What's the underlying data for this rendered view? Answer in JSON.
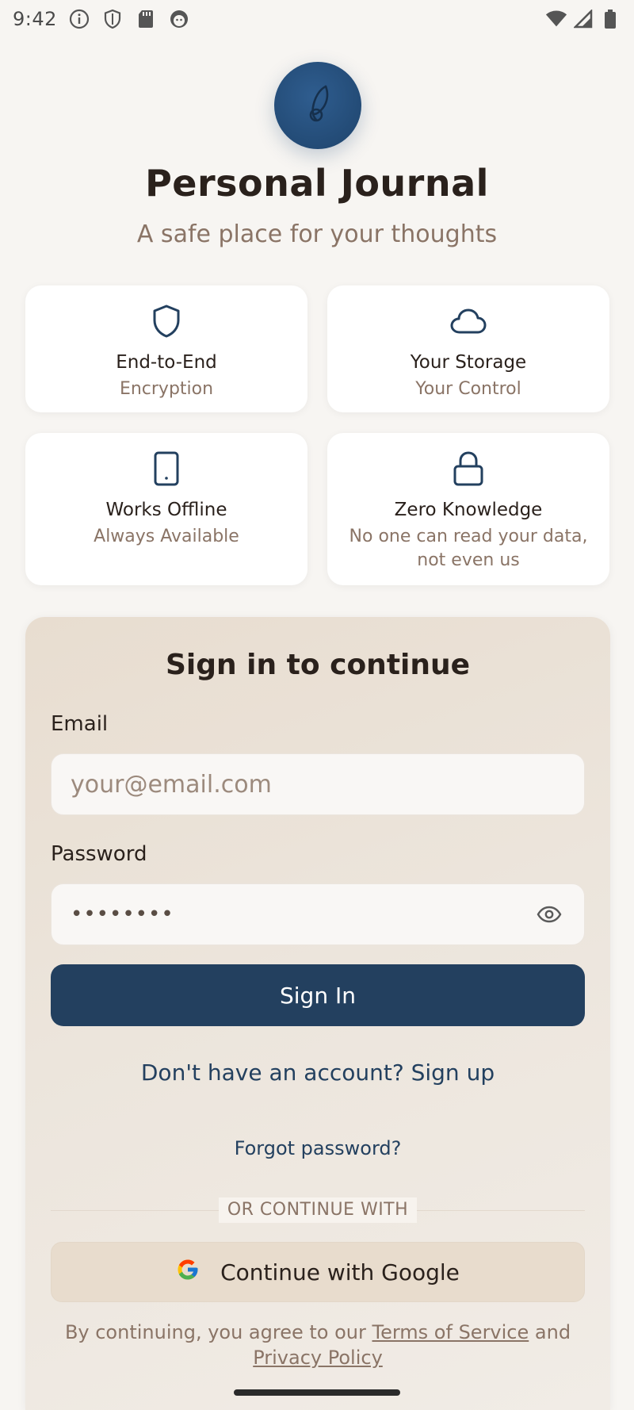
{
  "status_bar": {
    "time": "9:42",
    "left_icons": [
      "info-icon",
      "shield-icon",
      "sd-card-icon",
      "android-icon"
    ],
    "right_icons": [
      "wifi-icon",
      "cellular-signal-icon",
      "battery-icon"
    ]
  },
  "header": {
    "logo_icon": "feather-pen-icon",
    "title": "Personal Journal",
    "subtitle": "A safe place for your thoughts"
  },
  "features": [
    {
      "icon": "shield-icon",
      "title": "End-to-End",
      "description": "Encryption"
    },
    {
      "icon": "cloud-icon",
      "title": "Your Storage",
      "description": "Your Control"
    },
    {
      "icon": "phone-icon",
      "title": "Works Offline",
      "description": "Always Available"
    },
    {
      "icon": "lock-icon",
      "title": "Zero Knowledge",
      "description": "No one can read your data, not even us"
    }
  ],
  "signin": {
    "title": "Sign in to continue",
    "email_label": "Email",
    "email_placeholder": "your@email.com",
    "email_value": "",
    "password_label": "Password",
    "password_value": "••••••••",
    "submit_label": "Sign In",
    "signup_text": "Don't have an account? Sign up",
    "forgot_text": "Forgot password?",
    "divider_text": "OR CONTINUE WITH",
    "google_label": "Continue with Google",
    "terms_prefix": "By continuing, you agree to our",
    "terms_link": "Terms of Service",
    "terms_and": "and",
    "privacy_link": "Privacy Policy"
  },
  "colors": {
    "primary": "#23405f",
    "background": "#f7f5f2",
    "muted_text": "#8a7466",
    "card_bg": "#ffffff",
    "signin_card_bg": "#ece5dc"
  }
}
